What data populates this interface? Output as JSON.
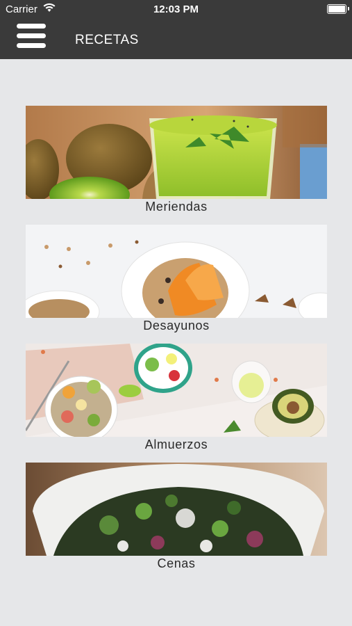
{
  "status_bar": {
    "carrier": "Carrier",
    "time": "12:03 PM"
  },
  "header": {
    "title": "RECETAS",
    "menu_icon": "hamburger-menu-icon"
  },
  "categories": [
    {
      "label": "Meriendas"
    },
    {
      "label": "Desayunos"
    },
    {
      "label": "Almuerzos"
    },
    {
      "label": "Cenas"
    }
  ]
}
